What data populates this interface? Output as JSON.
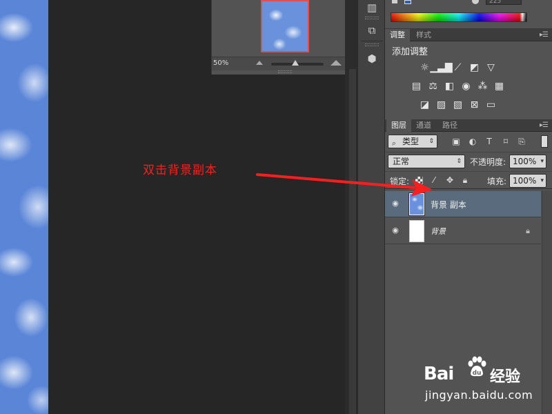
{
  "navigator": {
    "zoom_value": "50%"
  },
  "colors": {
    "annotation": "#ff1e1e",
    "selected_layer": "#596b7d",
    "panel_bg": "#535353",
    "canvas_bg": "#262626",
    "accent_blue": "#5b86d8"
  },
  "color_panel": {
    "value_text": "225"
  },
  "adjustments": {
    "tabs": [
      {
        "label": "调整",
        "active": true
      },
      {
        "label": "样式",
        "active": false
      }
    ],
    "title": "添加调整",
    "icon_rows": [
      [
        "brightness-contrast-icon",
        "levels-icon",
        "curves-icon",
        "exposure-icon",
        "vibrance-icon"
      ],
      [
        "hue-saturation-icon",
        "color-balance-icon",
        "black-white-icon",
        "photo-filter-icon",
        "channel-mixer-icon",
        "color-lookup-icon"
      ],
      [
        "invert-icon",
        "posterize-icon",
        "threshold-icon",
        "selective-color-icon",
        "gradient-map-icon"
      ]
    ]
  },
  "layers_panel": {
    "tabs": [
      {
        "label": "图层",
        "active": true
      },
      {
        "label": "通道",
        "active": false
      },
      {
        "label": "路径",
        "active": false
      }
    ],
    "filter": {
      "label": "类型"
    },
    "blend_mode": "正常",
    "opacity_label": "不透明度:",
    "opacity_value": "100%",
    "lock_label": "锁定:",
    "fill_label": "填充:",
    "fill_value": "100%",
    "layers": [
      {
        "name": "背景 副本",
        "selected": true,
        "thumb": "clouds",
        "locked": false
      },
      {
        "name": "背景",
        "selected": false,
        "thumb": "white",
        "locked": true
      }
    ]
  },
  "annotation": {
    "text": "双击背景副本"
  },
  "watermark": {
    "brand": "Bai",
    "brand_cn": "经验",
    "url": "jingyan.baidu.com"
  }
}
